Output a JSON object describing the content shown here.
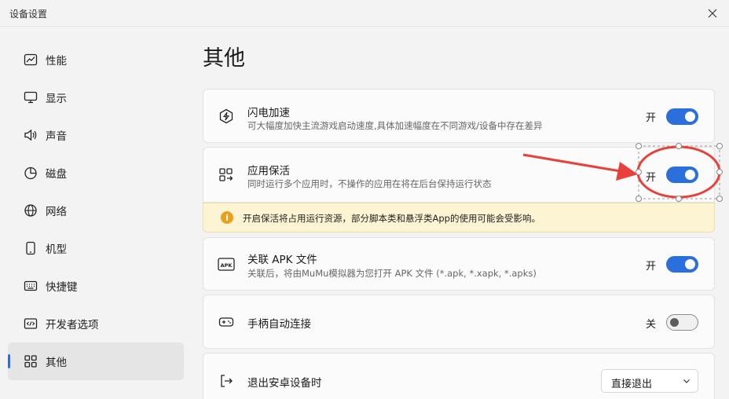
{
  "window": {
    "title": "设备设置"
  },
  "sidebar": {
    "items": [
      {
        "label": "性能",
        "icon": "chart-line-icon"
      },
      {
        "label": "显示",
        "icon": "monitor-icon"
      },
      {
        "label": "声音",
        "icon": "speaker-icon"
      },
      {
        "label": "磁盘",
        "icon": "pie-chart-icon"
      },
      {
        "label": "网络",
        "icon": "globe-icon"
      },
      {
        "label": "机型",
        "icon": "phone-icon"
      },
      {
        "label": "快捷键",
        "icon": "keyboard-icon"
      },
      {
        "label": "开发者选项",
        "icon": "code-icon"
      },
      {
        "label": "其他",
        "icon": "grid-icon",
        "active": true
      }
    ]
  },
  "main": {
    "title": "其他",
    "settings": {
      "flash": {
        "title": "闪电加速",
        "desc": "可大幅度加快主流游戏启动速度,具体加速幅度在不同游戏/设备中存在差异",
        "state": "开",
        "on": true,
        "icon": "bolt-hexagon-icon"
      },
      "keepalive": {
        "title": "应用保活",
        "desc": "同时运行多个应用时，不操作的应用在将在后台保持运行状态",
        "state": "开",
        "on": true,
        "icon": "apps-arrow-icon"
      },
      "warning": {
        "text": "开启保活将占用运行资源，部分脚本类和悬浮类App的使用可能会受影响。",
        "icon": "info-icon",
        "color": "#e9a11d"
      },
      "apk": {
        "title": "关联 APK 文件",
        "desc": "关联后，将由MuMu模拟器为您打开 APK 文件 (*.apk, *.xapk, *.apks)",
        "state": "开",
        "on": true,
        "icon": "apk-icon",
        "icon_text": "APK"
      },
      "gamepad": {
        "title": "手柄自动连接",
        "state": "关",
        "on": false,
        "icon": "gamepad-icon"
      },
      "exit": {
        "title": "退出安卓设备时",
        "selected": "直接退出",
        "icon": "exit-icon"
      }
    }
  },
  "colors": {
    "accent": "#2a6fdb",
    "annotation": "#e8413c"
  }
}
